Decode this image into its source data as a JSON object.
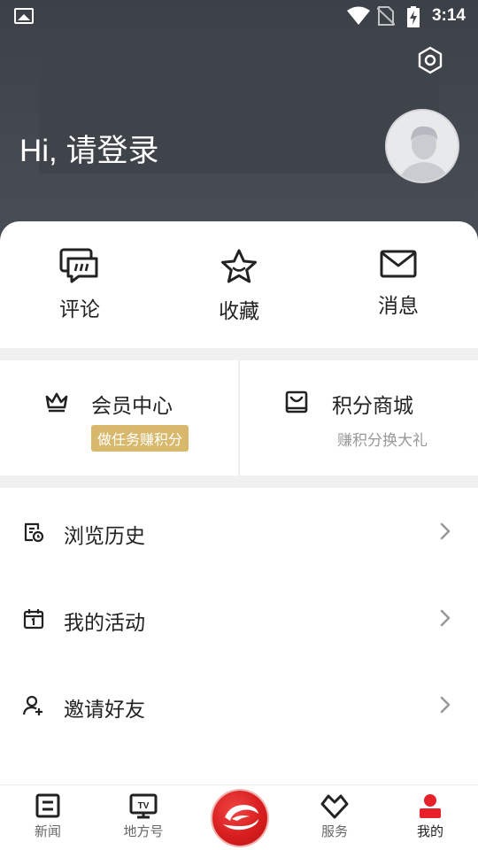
{
  "status_bar": {
    "time": "3:14"
  },
  "profile": {
    "greeting": "Hi, 请登录"
  },
  "shortcuts": [
    {
      "label": "评论",
      "icon": "comment-icon"
    },
    {
      "label": "收藏",
      "icon": "star-icon"
    },
    {
      "label": "消息",
      "icon": "mail-icon"
    }
  ],
  "member_center": {
    "title": "会员中心",
    "badge": "做任务赚积分",
    "icon": "crown-icon"
  },
  "points_mall": {
    "title": "积分商城",
    "subtitle": "赚积分换大礼",
    "icon": "shopping-box-icon"
  },
  "menu": [
    {
      "label": "浏览历史",
      "icon": "history-icon"
    },
    {
      "label": "我的活动",
      "icon": "calendar-icon"
    },
    {
      "label": "邀请好友",
      "icon": "add-user-icon"
    }
  ],
  "bottom_nav": [
    {
      "label": "新闻",
      "icon": "news-icon"
    },
    {
      "label": "地方号",
      "icon": "tv-icon"
    },
    {
      "label": "",
      "icon": "app-logo-icon"
    },
    {
      "label": "服务",
      "icon": "heart-outline-icon"
    },
    {
      "label": "我的",
      "icon": "person-icon",
      "active": true
    }
  ],
  "colors": {
    "accent": "#e8202a",
    "badge": "#d8b86a",
    "header": "#41454c"
  }
}
